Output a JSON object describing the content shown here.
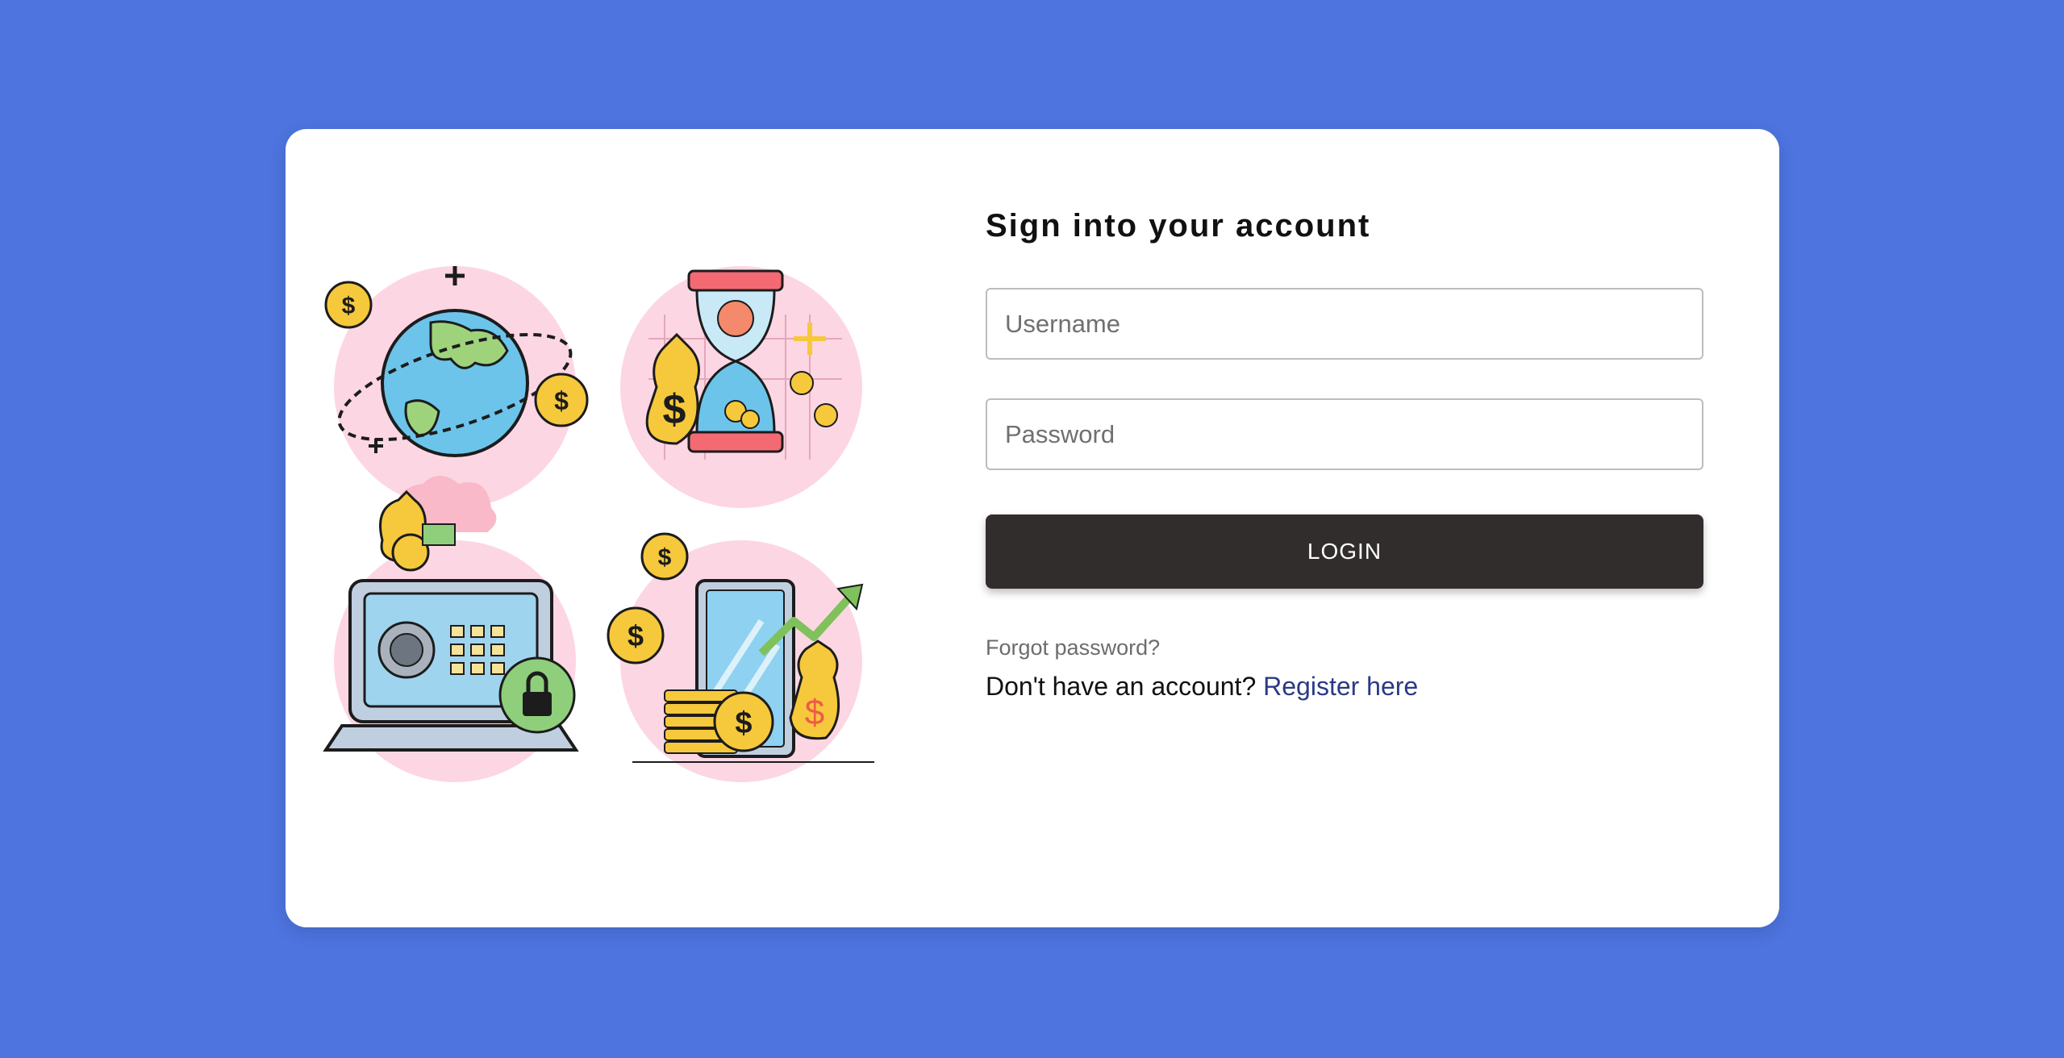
{
  "login": {
    "title": "Sign into your account",
    "username_placeholder": "Username",
    "password_placeholder": "Password",
    "login_label": "LOGIN",
    "forgot_label": "Forgot password?",
    "register_prompt": "Don't have an account?",
    "register_label": "Register here"
  },
  "colors": {
    "background": "#4d74df",
    "card": "#ffffff",
    "button": "#322d2d",
    "link": "#2a3a87",
    "illustration_blob": "#fdd6e3",
    "coin": "#f6c83c"
  },
  "illustration": {
    "icons": [
      "globe-coins-icon",
      "hourglass-money-icon",
      "laptop-safe-icon",
      "phone-growth-icon"
    ]
  }
}
